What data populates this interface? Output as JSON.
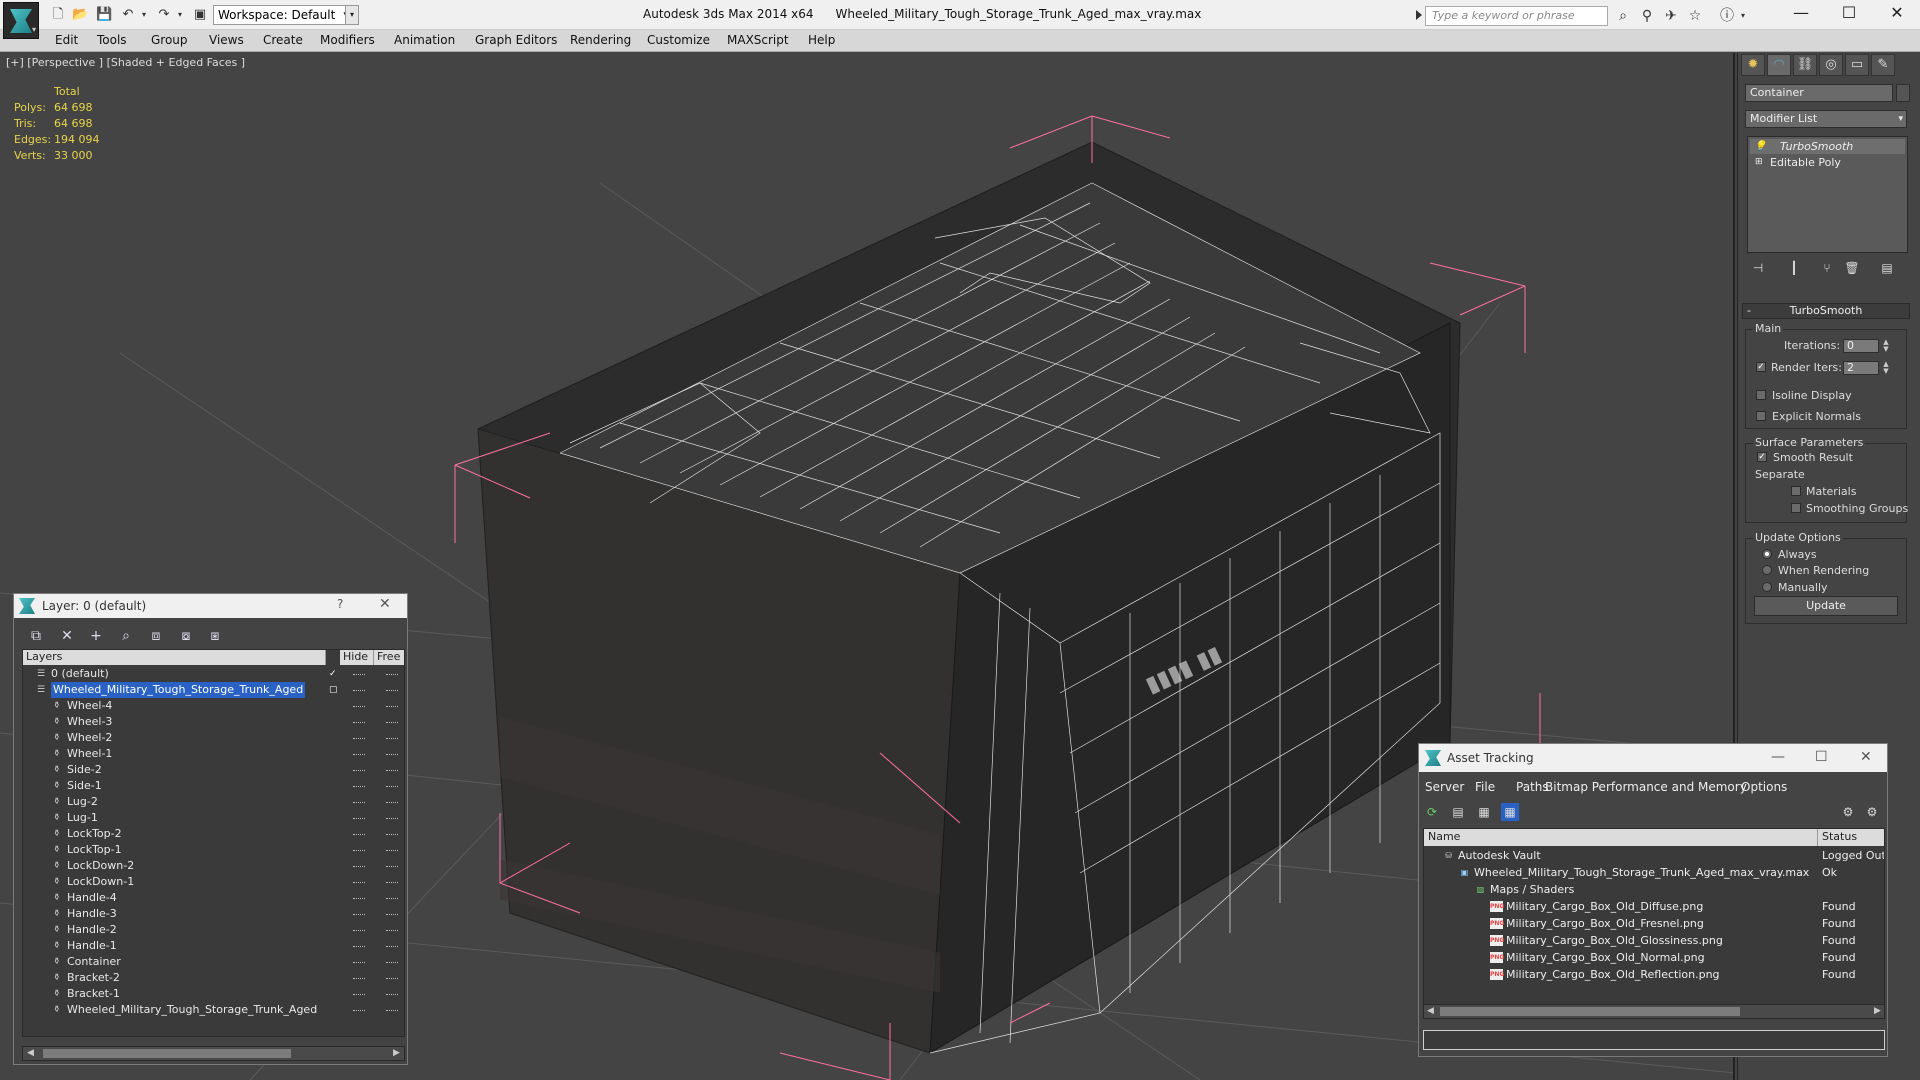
{
  "app": {
    "name": "Autodesk 3ds Max  2014 x64",
    "file": "Wheeled_Military_Tough_Storage_Trunk_Aged_max_vray.max",
    "workspace": "Workspace: Default",
    "search_placeholder": "Type a keyword or phrase"
  },
  "menu": [
    "Edit",
    "Tools",
    "Group",
    "Views",
    "Create",
    "Modifiers",
    "Animation",
    "Graph Editors",
    "Rendering",
    "Customize",
    "MAXScript",
    "Help"
  ],
  "viewport": {
    "label": "[+] [Perspective ] [Shaded + Edged Faces ]",
    "stats": {
      "header": "Total",
      "rows": [
        {
          "key": "Polys:",
          "value": "64 698"
        },
        {
          "key": "Tris:",
          "value": "64 698"
        },
        {
          "key": "Edges:",
          "value": "194 094"
        },
        {
          "key": "Verts:",
          "value": "33 000"
        }
      ]
    }
  },
  "command_panel": {
    "object_name": "Container",
    "modifier_list": "Modifier List",
    "stack": [
      "TurboSmooth",
      "Editable Poly"
    ],
    "turbosmooth": {
      "title": "TurboSmooth",
      "main": "Main",
      "iterations_label": "Iterations:",
      "iterations": "0",
      "render_iters_label": "Render Iters:",
      "render_iters": "2",
      "isoline": "Isoline Display",
      "explicit_normals": "Explicit Normals",
      "surface_params": "Surface Parameters",
      "smooth_result": "Smooth Result",
      "separate": "Separate",
      "materials": "Materials",
      "smoothing_groups": "Smoothing Groups",
      "update_options": "Update Options",
      "always": "Always",
      "when_rendering": "When Rendering",
      "manually": "Manually",
      "update_btn": "Update"
    }
  },
  "layer_dialog": {
    "title": "Layer: 0 (default)",
    "help": "?",
    "columns": [
      "Layers",
      "Hide",
      "Free"
    ],
    "rows": [
      {
        "name": "0 (default)",
        "level": 0,
        "checked": true
      },
      {
        "name": "Wheeled_Military_Tough_Storage_Trunk_Aged",
        "level": 0,
        "selected": true
      },
      {
        "name": "Wheel-4",
        "level": 1
      },
      {
        "name": "Wheel-3",
        "level": 1
      },
      {
        "name": "Wheel-2",
        "level": 1
      },
      {
        "name": "Wheel-1",
        "level": 1
      },
      {
        "name": "Side-2",
        "level": 1
      },
      {
        "name": "Side-1",
        "level": 1
      },
      {
        "name": "Lug-2",
        "level": 1
      },
      {
        "name": "Lug-1",
        "level": 1
      },
      {
        "name": "LockTop-2",
        "level": 1
      },
      {
        "name": "LockTop-1",
        "level": 1
      },
      {
        "name": "LockDown-2",
        "level": 1
      },
      {
        "name": "LockDown-1",
        "level": 1
      },
      {
        "name": "Handle-4",
        "level": 1
      },
      {
        "name": "Handle-3",
        "level": 1
      },
      {
        "name": "Handle-2",
        "level": 1
      },
      {
        "name": "Handle-1",
        "level": 1
      },
      {
        "name": "Container",
        "level": 1
      },
      {
        "name": "Bracket-2",
        "level": 1
      },
      {
        "name": "Bracket-1",
        "level": 1
      },
      {
        "name": "Wheeled_Military_Tough_Storage_Trunk_Aged",
        "level": 1
      }
    ]
  },
  "asset_tracking": {
    "title": "Asset Tracking",
    "menu": [
      "Server",
      "File",
      "Paths",
      "Bitmap Performance and Memory",
      "Options"
    ],
    "columns": [
      "Name",
      "Status"
    ],
    "rows": [
      {
        "name": "Autodesk Vault",
        "status": "Logged Out",
        "level": 0,
        "icon": "vault"
      },
      {
        "name": "Wheeled_Military_Tough_Storage_Trunk_Aged_max_vray.max",
        "status": "Ok",
        "level": 1,
        "icon": "file"
      },
      {
        "name": "Maps / Shaders",
        "status": "",
        "level": 2,
        "icon": "folder"
      },
      {
        "name": "Military_Cargo_Box_Old_Diffuse.png",
        "status": "Found",
        "level": 3,
        "icon": "png"
      },
      {
        "name": "Military_Cargo_Box_Old_Fresnel.png",
        "status": "Found",
        "level": 3,
        "icon": "png"
      },
      {
        "name": "Military_Cargo_Box_Old_Glossiness.png",
        "status": "Found",
        "level": 3,
        "icon": "png"
      },
      {
        "name": "Military_Cargo_Box_Old_Normal.png",
        "status": "Found",
        "level": 3,
        "icon": "png"
      },
      {
        "name": "Military_Cargo_Box_Old_Reflection.png",
        "status": "Found",
        "level": 3,
        "icon": "png"
      }
    ]
  },
  "colors": {
    "viewport_bg": "#444444",
    "selection": "#2962c4",
    "stats_text": "#e8d44a",
    "bbox_line": "#ff6fa5"
  }
}
